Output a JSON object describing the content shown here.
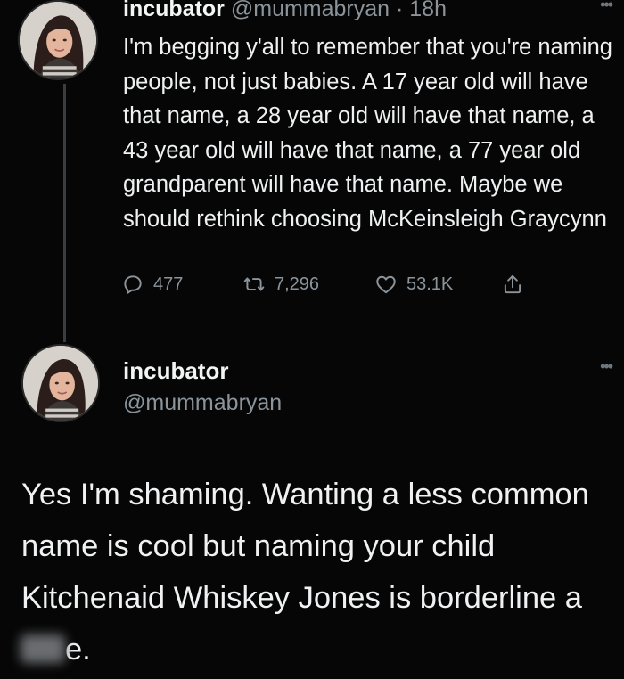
{
  "tweet1": {
    "display_name": "incubator",
    "handle_meta": "@mummabryan · 18h",
    "more_icon": "more-dots-icon",
    "text": "I'm begging y'all to remember that you're naming people, not just babies. A 17 year old will have that name, a 28 year old will have that name, a 43 year old will have that name, a 77 year old grandparent will have that name. Maybe we should rethink choosing McKeinsleigh Graycynn",
    "actions": {
      "replies": "477",
      "retweets": "7,296",
      "likes": "53.1K",
      "icons": [
        "reply-icon",
        "retweet-icon",
        "like-icon",
        "share-icon"
      ]
    }
  },
  "tweet2": {
    "display_name": "incubator",
    "handle": "@mummabryan",
    "more_icon": "more-dots-icon",
    "text_before": "Yes I'm shaming. Wanting a less common name is cool but naming your child Kitchenaid Whiskey Jones is borderline a",
    "text_after": "e."
  },
  "colors": {
    "background": "#060606",
    "text": "#eef0f1",
    "muted": "#8b949b",
    "thread_line": "#3a3d40"
  }
}
